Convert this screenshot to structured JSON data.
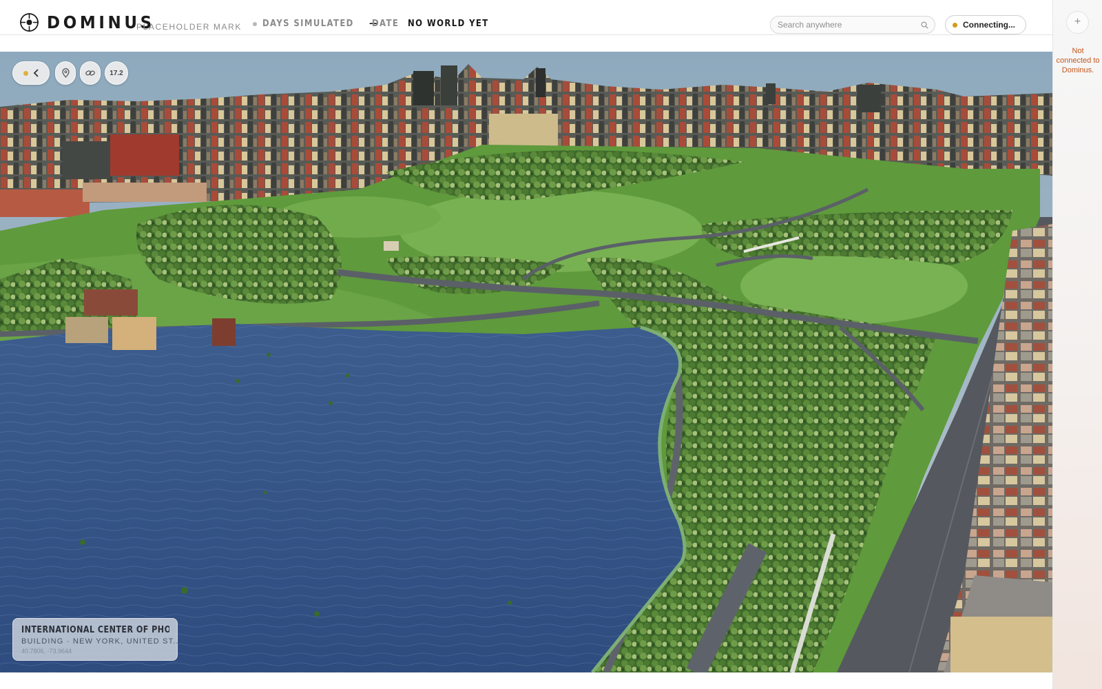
{
  "header": {
    "brand": "DOMINUS",
    "brand_mark": "PLACEHOLDER MARK",
    "days_label": "DAYS SIMULATED",
    "days_value": "—",
    "date_label": "DATE",
    "date_value": "NO WORLD YET",
    "search": {
      "placeholder": "Search anywhere",
      "value": ""
    },
    "connection": {
      "label": "Connecting...",
      "status_color": "#d39a1a"
    }
  },
  "rail": {
    "add_label": "+",
    "message": "Not connected to Dominus."
  },
  "map": {
    "controls": {
      "back": "back",
      "pin": "pin",
      "link": "link",
      "zoom": "17.2"
    },
    "selection": {
      "title": "INTERNATIONAL CENTER OF PHOTOG...",
      "subtitle": "BUILDING · NEW YORK, UNITED ST...",
      "coordinates": "40.7806, -73.9644"
    }
  },
  "icons": {
    "logo": "crosshair-logo-icon",
    "search": "search-icon",
    "back": "chevron-left-icon",
    "pin": "map-pin-icon",
    "link": "link-icon"
  },
  "colors": {
    "accent_orange": "#c2551b",
    "connecting": "#d39a1a",
    "sun": "#e0b13a"
  }
}
